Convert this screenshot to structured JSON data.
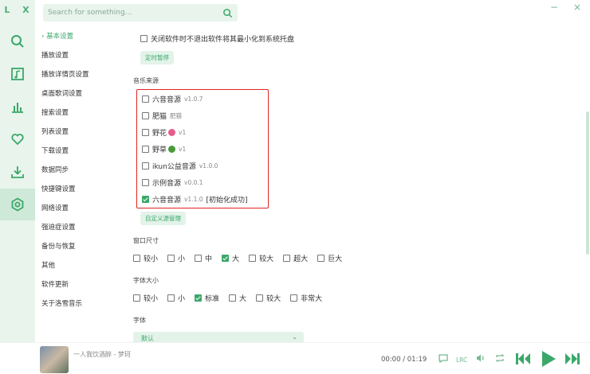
{
  "window": {
    "logo": "L X",
    "minimize": "−",
    "close": "×"
  },
  "search": {
    "placeholder": "Search for something..."
  },
  "rail": [
    {
      "name": "search-icon"
    },
    {
      "name": "music-note-icon"
    },
    {
      "name": "chart-bars-icon"
    },
    {
      "name": "heart-icon"
    },
    {
      "name": "download-icon"
    },
    {
      "name": "settings-icon",
      "active": true
    }
  ],
  "nav": {
    "items": [
      "基本设置",
      "播放设置",
      "播放详情页设置",
      "桌面歌词设置",
      "搜索设置",
      "列表设置",
      "下载设置",
      "数据同步",
      "快捷键设置",
      "网络设置",
      "强迫症设置",
      "备份与恢复",
      "其他",
      "软件更新",
      "关于洛雪音乐"
    ]
  },
  "content": {
    "minimize_to_tray": {
      "label": "关闭软件时不退出软件将其最小化到系统托盘",
      "checked": false
    },
    "timer_button": "定时暂停",
    "music_source": {
      "title": "音乐来源",
      "items": [
        {
          "name": "六音音源",
          "ver": "v1.0.7",
          "checked": false
        },
        {
          "name": "肥猫",
          "ver": "肥猫",
          "checked": false
        },
        {
          "name": "野花",
          "ver": "v1",
          "checked": false,
          "emoji_color": "#e85a8a"
        },
        {
          "name": "野草",
          "ver": "v1",
          "checked": false,
          "emoji_color": "#4a9a3a"
        },
        {
          "name": "ikun公益音源",
          "ver": "v1.0.0",
          "checked": false
        },
        {
          "name": "示例音源",
          "ver": "v0.0.1",
          "checked": false
        },
        {
          "name": "六音音源",
          "ver": "v1.1.0",
          "extra": "[初始化成功]",
          "checked": true
        }
      ],
      "custom_button": "自定义源管理"
    },
    "window_size": {
      "title": "窗口尺寸",
      "options": [
        "较小",
        "小",
        "中",
        "大",
        "较大",
        "超大",
        "巨大"
      ],
      "selected": "大"
    },
    "font_size": {
      "title": "字体大小",
      "options": [
        "较小",
        "小",
        "标准",
        "大",
        "较大",
        "非常大"
      ],
      "selected": "标准"
    },
    "font": {
      "title": "字体",
      "value": "默认"
    }
  },
  "player": {
    "song": "一人我饮酒醉 - 梦珂",
    "time": "00:00 / 01:19",
    "lrc": "LRC"
  },
  "colors": {
    "accent": "#3aa86a",
    "rail_bg": "#e8f4ec",
    "highlight": "#e02424"
  }
}
